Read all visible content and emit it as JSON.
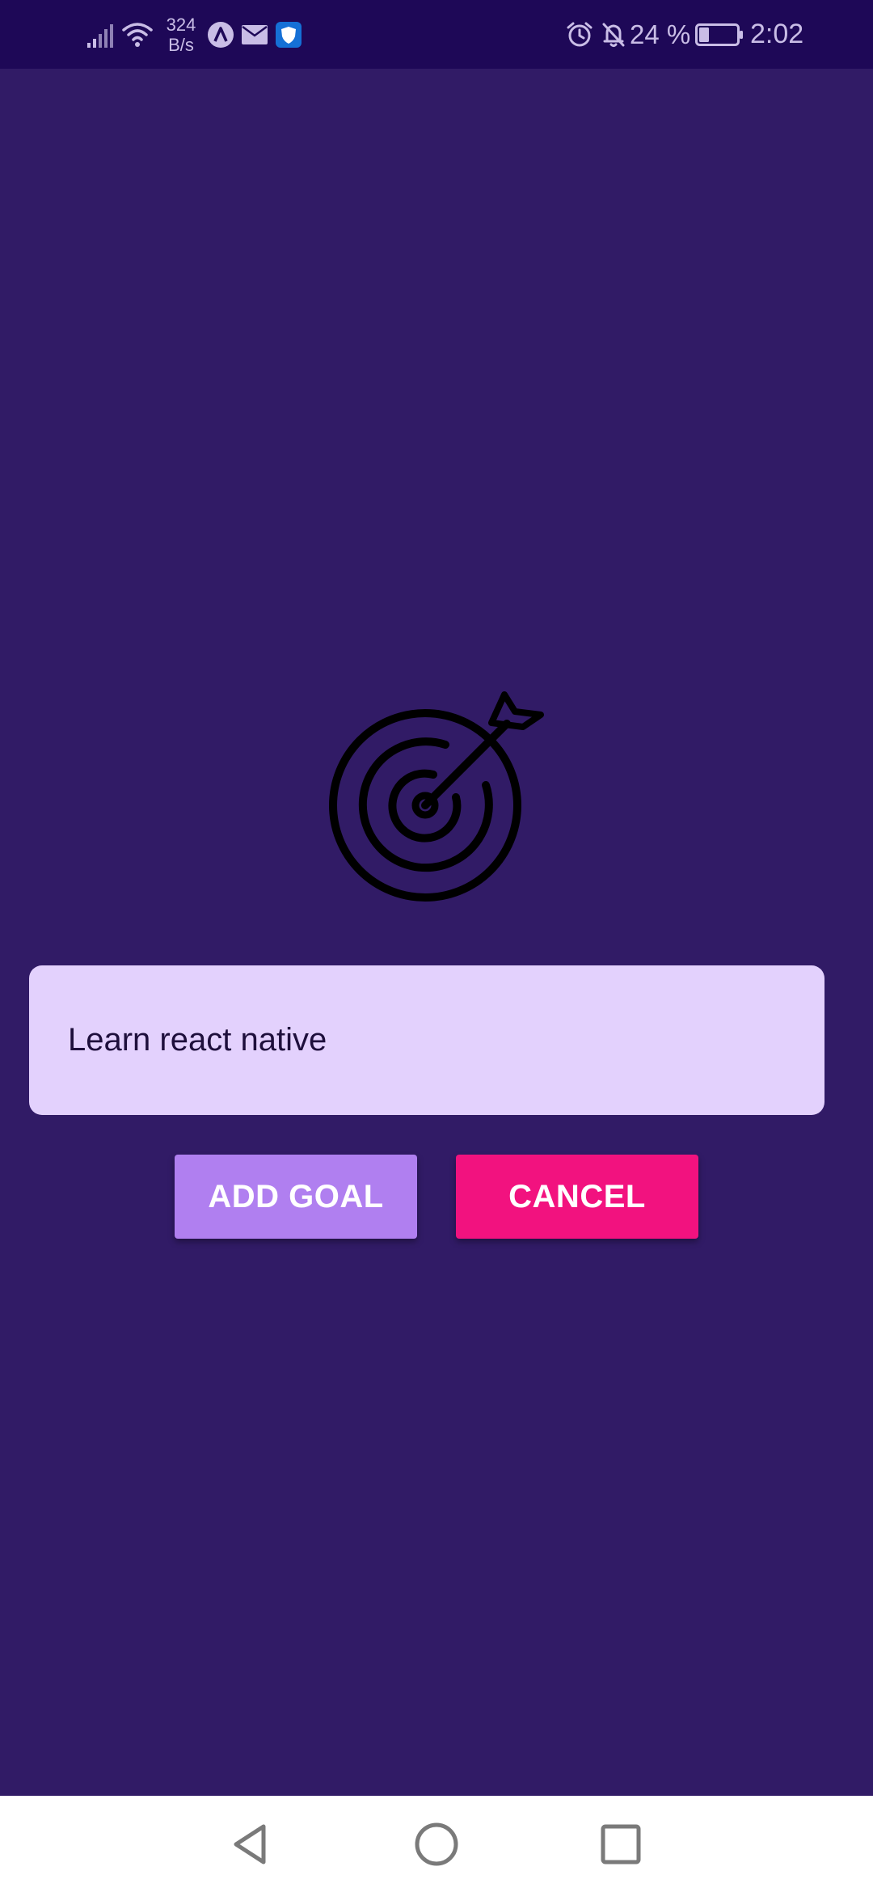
{
  "status_bar": {
    "net_speed_value": "324",
    "net_speed_unit": "B/s",
    "battery_percent": "24 %",
    "time": "2:02",
    "icons": [
      "signal-icon",
      "wifi-icon",
      "app-a-icon",
      "mail-icon",
      "shield-icon",
      "alarm-icon",
      "bell-off-icon",
      "battery-icon"
    ]
  },
  "main": {
    "goal_image_icon": "target-arrow-icon",
    "goal_input_value": "Learn react native",
    "add_button_label": "ADD GOAL",
    "cancel_button_label": "CANCEL"
  },
  "navigation": {
    "icons": [
      "back-triangle-icon",
      "home-circle-icon",
      "recent-square-icon"
    ]
  },
  "colors": {
    "status_bar_bg": "#1e0857",
    "background": "#311b66",
    "input_bg": "#e3d1fd",
    "add_button": "#b07ff0",
    "cancel_button": "#f2127f",
    "nav_bar_bg": "#ffffff"
  }
}
